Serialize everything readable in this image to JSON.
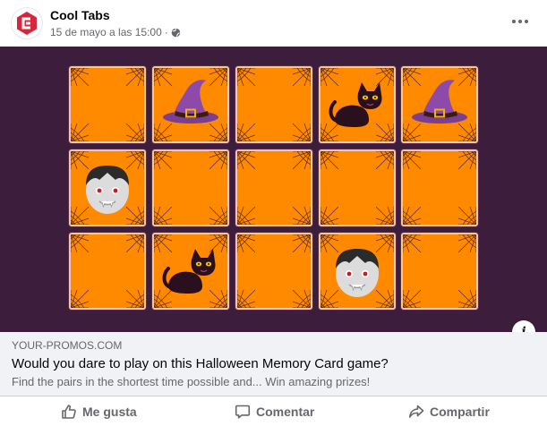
{
  "post": {
    "page_name": "Cool Tabs",
    "timestamp": "15 de mayo a las 15:00",
    "separator": "·",
    "audience_icon": "globe-icon",
    "more_icon": "more-dots-icon"
  },
  "game": {
    "background_color": "#3d1d3c",
    "card_color": "#ff8a00",
    "rows": [
      [
        "blank",
        "witch-hat",
        "blank",
        "black-cat",
        "witch-hat"
      ],
      [
        "vampire",
        "blank",
        "blank",
        "blank",
        "blank"
      ],
      [
        "blank",
        "black-cat",
        "blank",
        "vampire",
        "blank"
      ]
    ],
    "info_label": "i"
  },
  "link": {
    "domain": "YOUR-PROMOS.COM",
    "title": "Would you dare to play on this Halloween Memory Card game?",
    "description": "Find the pairs in the shortest time possible and... Win amazing prizes!"
  },
  "actions": {
    "like": "Me gusta",
    "comment": "Comentar",
    "share": "Compartir"
  }
}
